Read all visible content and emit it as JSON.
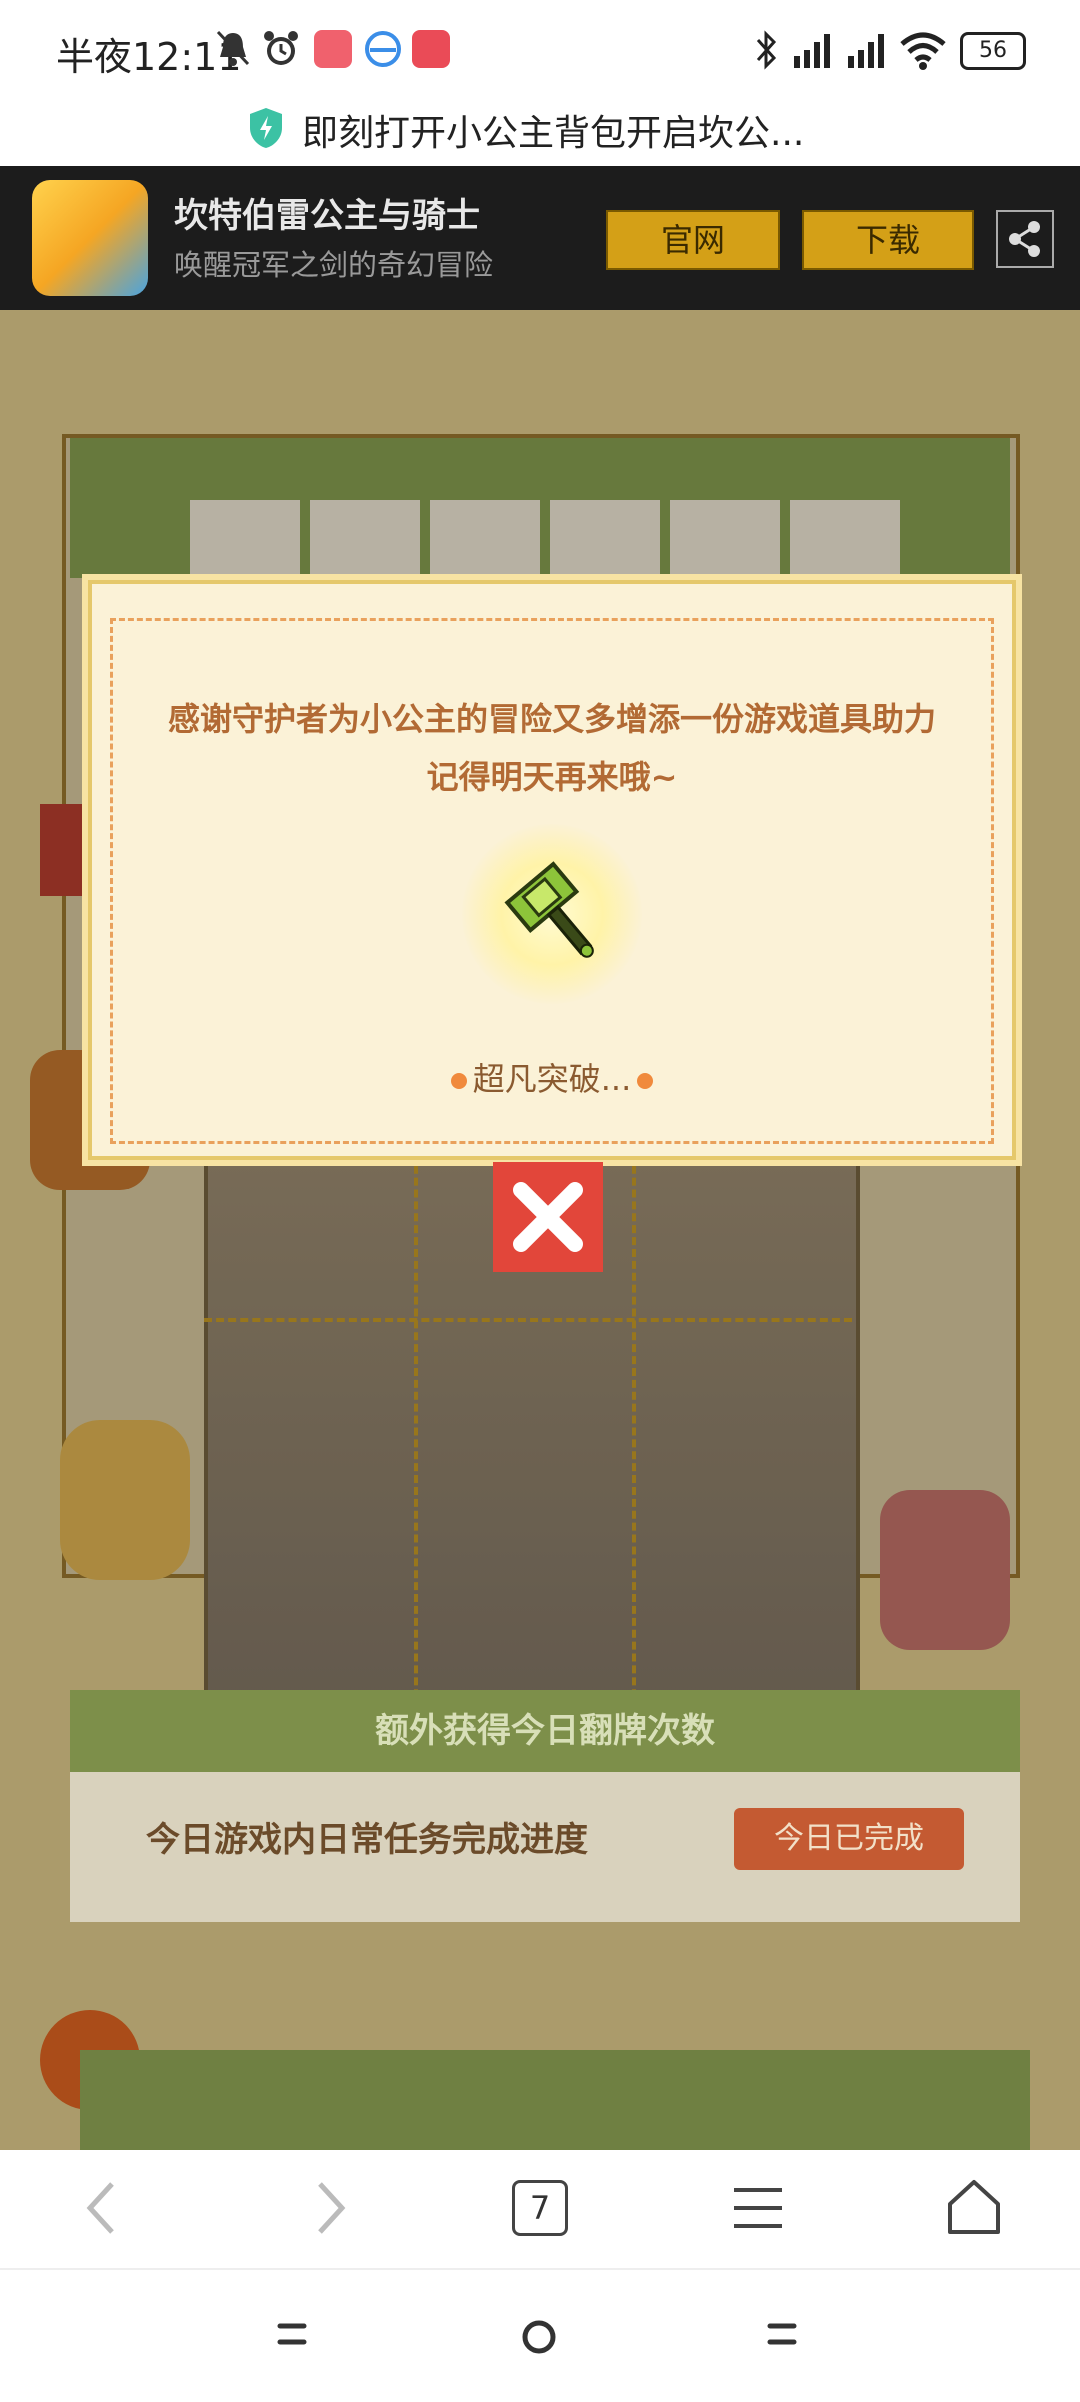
{
  "status_bar": {
    "time": "半夜12:11",
    "battery": "56"
  },
  "url_bar": {
    "text": "即刻打开小公主背包开启坎公..."
  },
  "app_banner": {
    "title": "坎特伯雷公主与骑士",
    "subtitle": "唤醒冠军之剑的奇幻冒险",
    "official_label": "官网",
    "download_label": "下载"
  },
  "modal": {
    "message_line1": "感谢守护者为小公主的冒险又多增添一份游戏道具助力",
    "message_line2": "记得明天再来哦~",
    "reward_hint": "超凡突破..."
  },
  "task_panel": {
    "header": "额外获得今日翻牌次数",
    "label": "今日游戏内日常任务完成进度",
    "status_button": "今日已完成"
  },
  "toolbar": {
    "tab_count": "7"
  },
  "colors": {
    "banner_bg": "#1c1c1c",
    "banner_button": "#d4a017",
    "modal_bg": "#fbf2d7",
    "modal_text": "#b26a34",
    "close_button": "#e2463a",
    "task_button": "#c45a32"
  }
}
